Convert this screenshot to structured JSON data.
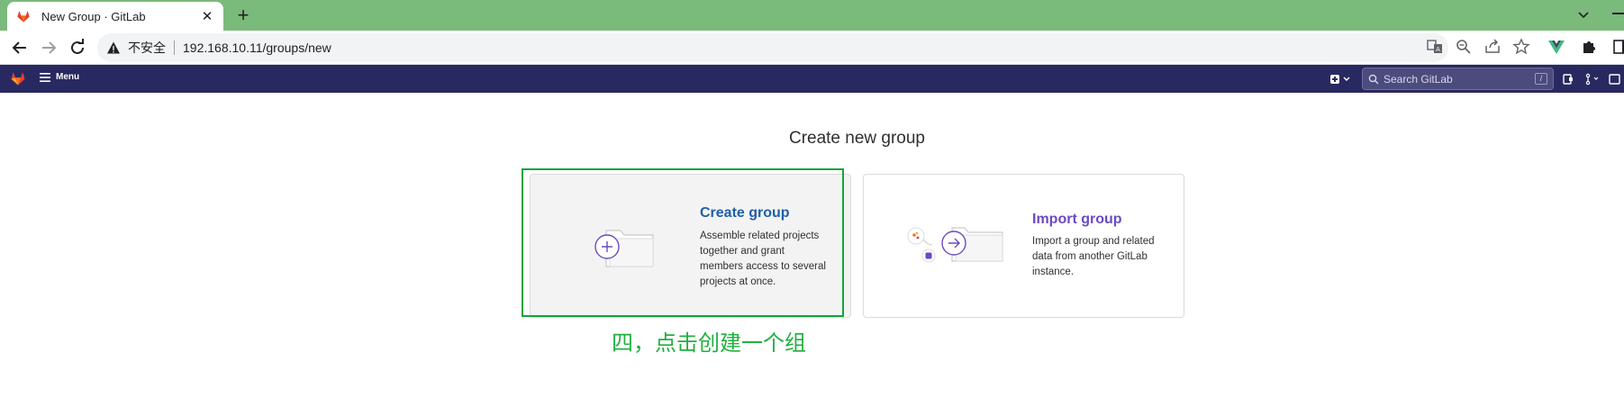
{
  "browser": {
    "tab_title": "New Group · GitLab",
    "tab_close": "✕",
    "new_tab": "+",
    "security_label": "不安全",
    "url": "192.168.10.11/groups/new"
  },
  "navbar": {
    "menu_label": "Menu",
    "search_placeholder": "Search GitLab",
    "search_shortcut": "/"
  },
  "page": {
    "title": "Create new group",
    "cards": [
      {
        "title": "Create group",
        "description": "Assemble related projects together and grant members access to several projects at once."
      },
      {
        "title": "Import group",
        "description": "Import a group and related data from another GitLab instance."
      }
    ],
    "annotation": "四，点击创建一个组"
  },
  "colors": {
    "tab_strip": "#7aba7a",
    "gitlab_nav": "#292961",
    "create_title": "#1f5fa7",
    "import_title": "#6a49c4",
    "annotation": "#22b03f"
  }
}
